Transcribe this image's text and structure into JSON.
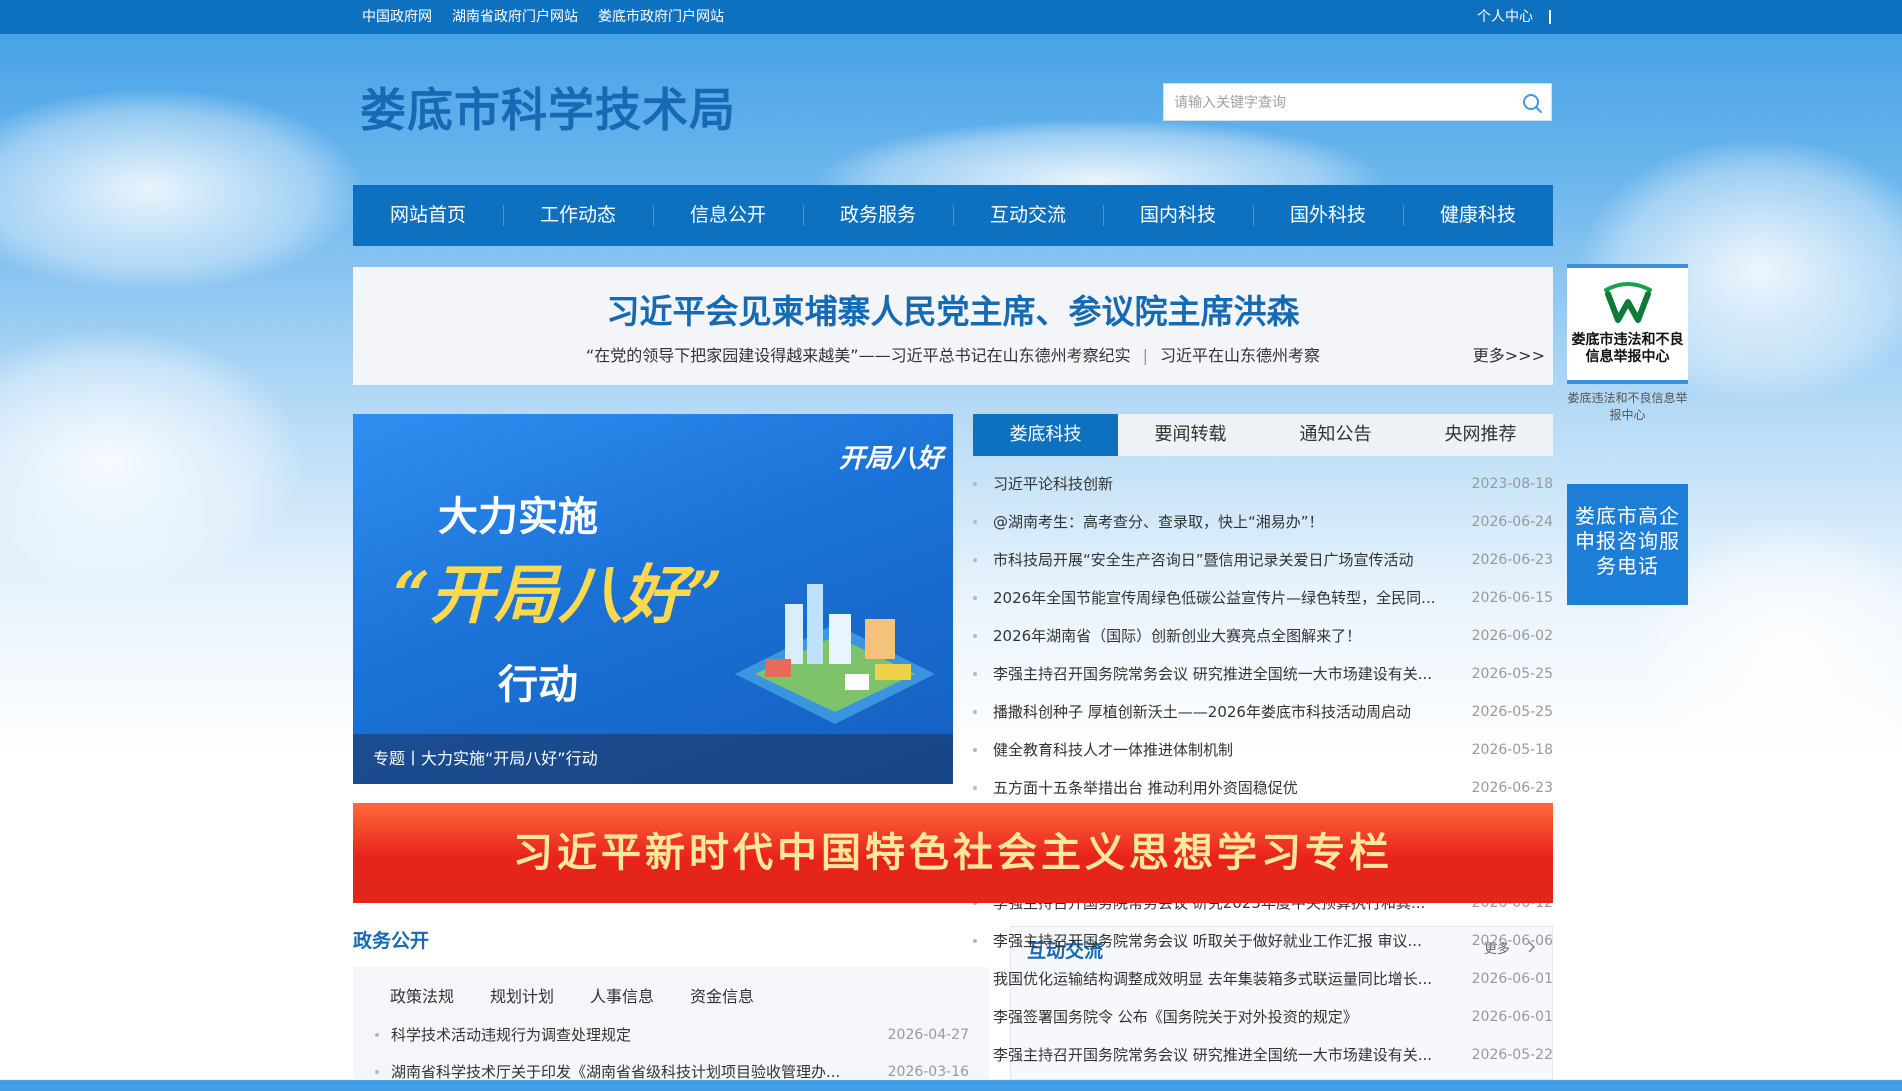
{
  "topbar": {
    "links": [
      "中国政府网",
      "湖南省政府门户网站",
      "娄底市政府门户网站"
    ],
    "user_center": "个人中心"
  },
  "header": {
    "site_title": "娄底市科学技术局",
    "search_placeholder": "请输入关键字查询"
  },
  "nav": {
    "items": [
      "网站首页",
      "工作动态",
      "信息公开",
      "政务服务",
      "互动交流",
      "国内科技",
      "国外科技",
      "健康科技"
    ]
  },
  "headline": {
    "title": "习近平会见柬埔寨人民党主席、参议院主席洪森",
    "sub1": "“在党的领导下把家园建设得越来越美”——习近平总书记在山东德州考察纪实",
    "sub_sep": "|",
    "sub2": "习近平在山东德州考察",
    "more": "更多>>>"
  },
  "side": {
    "float1_title": "娄底市违法和不良信息举报中心",
    "float1_caption": "娄底违法和不良信息举报中心",
    "float2_title": "娄底市高企申报咨询服务电话"
  },
  "feature": {
    "badge": "开局八好",
    "line1": "大力实施",
    "line2": "“开局八好”",
    "line3": "行动",
    "caption": "专题丨大力实施“开局八好”行动"
  },
  "tabs": [
    "娄底科技",
    "要闻转载",
    "通知公告",
    "央网推荐"
  ],
  "news": [
    {
      "title": "习近平论科技创新",
      "date": "2023-08-18"
    },
    {
      "title": "@湖南考生：高考查分、查录取，快上“湘易办”！",
      "date": "2026-06-24"
    },
    {
      "title": "市科技局开展“安全生产咨询日”暨信用记录关爱日广场宣传活动",
      "date": "2026-06-23"
    },
    {
      "title": "2026年全国节能宣传周绿色低碳公益宣传片—绿色转型，全民同...",
      "date": "2026-06-15"
    },
    {
      "title": "2026年湖南省（国际）创新创业大赛亮点全图解来了！",
      "date": "2026-06-02"
    },
    {
      "title": "李强主持召开国务院常务会议 研究推进全国统一大市场建设有关...",
      "date": "2026-05-25"
    },
    {
      "title": "播撒科创种子 厚植创新沃土——2026年娄底市科技活动周启动",
      "date": "2026-05-25"
    },
    {
      "title": "健全教育科技人才一体推进体制机制",
      "date": "2026-05-18"
    },
    {
      "title": "五方面十五条举措出台 推动利用外资固稳促优",
      "date": "2026-06-23"
    },
    {
      "title": "李强主持召开国务院常务会议 研究2025年度中央预算执行和其...",
      "date": "2026-06-12"
    },
    {
      "title": "李强主持召开国务院常务会议 听取关于做好就业工作汇报 审议...",
      "date": "2026-06-06"
    },
    {
      "title": "我国优化运输结构调整成效明显 去年集装箱多式联运量同比增长...",
      "date": "2026-06-01"
    },
    {
      "title": "李强签署国务院令 公布《国务院关于对外投资的规定》",
      "date": "2026-06-01"
    },
    {
      "title": "李强主持召开国务院常务会议 研究推进全国统一大市场建设有关...",
      "date": "2026-05-22"
    }
  ],
  "banner": {
    "text": "习近平新时代中国特色社会主义思想学习专栏"
  },
  "zwgk": {
    "title": "政务公开",
    "tabs": [
      "政策法规",
      "规划计划",
      "人事信息",
      "资金信息"
    ],
    "rows": [
      {
        "title": "科学技术活动违规行为调查处理规定",
        "date": "2026-04-27"
      },
      {
        "title": "湖南省科学技术厅关于印发《湖南省省级科技计划项目验收管理办...",
        "date": "2026-03-16"
      }
    ]
  },
  "hudong": {
    "title": "互动交流",
    "more": "更多"
  },
  "colors": {
    "brand_blue": "#0d71bf",
    "title_blue": "#1669b3",
    "banner_red": "#e8221c"
  }
}
